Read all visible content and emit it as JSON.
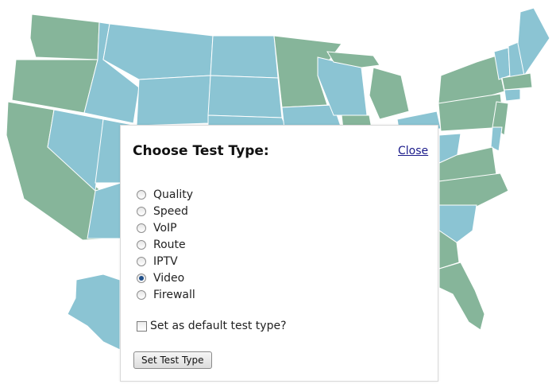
{
  "dialog": {
    "title": "Choose Test Type:",
    "close_label": "Close",
    "options": [
      {
        "label": "Quality",
        "selected": false
      },
      {
        "label": "Speed",
        "selected": false
      },
      {
        "label": "VoIP",
        "selected": false
      },
      {
        "label": "Route",
        "selected": false
      },
      {
        "label": "IPTV",
        "selected": false
      },
      {
        "label": "Video",
        "selected": true
      },
      {
        "label": "Firewall",
        "selected": false
      }
    ],
    "default_label": "Set as default test type?",
    "default_checked": false,
    "button_label": "Set Test Type"
  },
  "colors": {
    "state_teal": "#8bc4d3",
    "state_green": "#86b59a"
  }
}
